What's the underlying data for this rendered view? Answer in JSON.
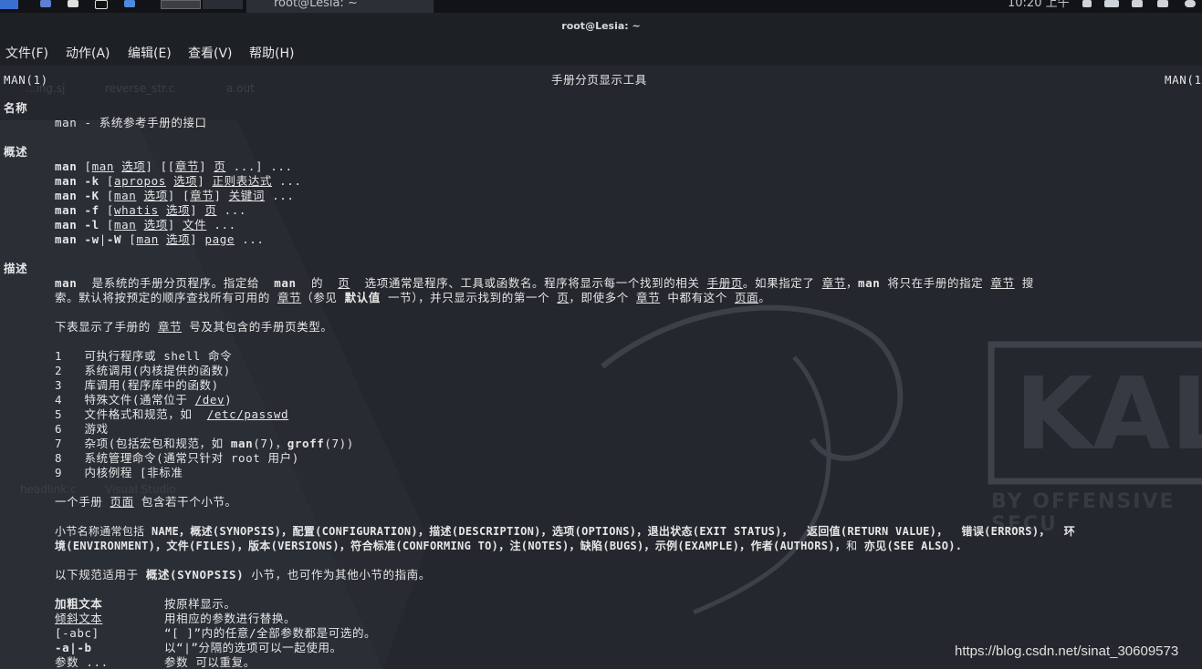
{
  "panel": {
    "window_title": "root@Lesia: ~",
    "time": "10:20 上午"
  },
  "titlebar": {
    "title": "root@Lesia: ~"
  },
  "menu": [
    {
      "label": "文件(F)"
    },
    {
      "label": "动作(A)"
    },
    {
      "label": "编辑(E)"
    },
    {
      "label": "查看(V)"
    },
    {
      "label": "帮助(H)"
    }
  ],
  "desktop_ghost": {
    "f1": "...ing.sj",
    "f2": "reverse_str.c",
    "f3": "a.out",
    "f4": "headlink.c",
    "f5": "Visual Studio",
    "wall_brand": "KAL",
    "wall_tagline": "BY OFFENSIVE SECU"
  },
  "man": {
    "header_left": "MAN(1)",
    "header_center": "手册分页显示工具",
    "header_right": "MAN(1",
    "sec_name": "名称",
    "name_line": "man - 系统参考手册的接口",
    "sec_synopsis": "概述",
    "syn1": {
      "cmd": "man",
      "t1": " [",
      "u1": "man",
      "t2": " ",
      "u2": "选项",
      "t3": "] [[",
      "u3": "章节",
      "t4": "] ",
      "u4": "页",
      "t5": " ...] ..."
    },
    "syn2": {
      "cmd": "man -k",
      "t1": " [",
      "u1": "apropos",
      "t2": " ",
      "u2": "选项",
      "t3": "] ",
      "u3": "正则表达式",
      "t4": " ..."
    },
    "syn3": {
      "cmd": "man -K",
      "t1": " [",
      "u1": "man",
      "t2": " ",
      "u2": "选项",
      "t3": "] [",
      "u3": "章节",
      "t4": "] ",
      "u4": "关键词",
      "t5": " ..."
    },
    "syn4": {
      "cmd": "man -f",
      "t1": " [",
      "u1": "whatis",
      "t2": " ",
      "u2": "选项",
      "t3": "] ",
      "u3": "页",
      "t4": " ..."
    },
    "syn5": {
      "cmd": "man -l",
      "t1": " [",
      "u1": "man",
      "t2": " ",
      "u2": "选项",
      "t3": "] ",
      "u3": "文件",
      "t4": " ..."
    },
    "syn6": {
      "cmd": "man -w",
      "t1": "|",
      "cmd2": "-W",
      "t2": " [",
      "u1": "man",
      "t3": " ",
      "u2": "选项",
      "t4": "] ",
      "u3": "page",
      "t5": " ..."
    },
    "sec_desc": "描述",
    "desc1": {
      "b1": "man",
      "t1": "  是系统的手册分页程序。指定给  ",
      "b2": "man",
      "t2": "  的  ",
      "u1": "页",
      "t3": "  选项通常是程序、工具或函数名。程序将显示每一个找到的相关 ",
      "u2": "手册页",
      "t4": "。如果指定了 ",
      "u3": "章节",
      "t5": "，",
      "b3": "man",
      "t6": " 将只在手册的指定 ",
      "u4": "章节",
      "t7": " 搜"
    },
    "desc2": {
      "t1": "索。默认将按预定的顺序查找所有可用的 ",
      "u1": "章节",
      "t2": "（参见 ",
      "b1": "默认值",
      "t3": " 一节），并只显示找到的第一个 ",
      "u2": "页",
      "t4": "，即使多个 ",
      "u3": "章节",
      "t5": " 中都有这个 ",
      "u4": "页面",
      "t6": "。"
    },
    "table_intro": {
      "t1": "下表显示了手册的 ",
      "u1": "章节",
      "t2": " 号及其包含的手册页类型。"
    },
    "sections": [
      {
        "num": "1",
        "text": "可执行程序或 shell 命令"
      },
      {
        "num": "2",
        "text": "系统调用(内核提供的函数)"
      },
      {
        "num": "3",
        "text": "库调用(程序库中的函数)"
      },
      {
        "num": "4",
        "text": "特殊文件(通常位于 ",
        "u": "/dev",
        "tail": ")"
      },
      {
        "num": "5",
        "text": "文件格式和规范，如  ",
        "u": "/etc/passwd",
        "tail": ""
      },
      {
        "num": "6",
        "text": "游戏"
      },
      {
        "num": "7",
        "text": "杂项(包括宏包和规范，如 ",
        "b1": "man",
        "m1": "(7)，",
        "b2": "groff",
        "m2": "(7))"
      },
      {
        "num": "8",
        "text": "系统管理命令(通常只针对 root 用户)"
      },
      {
        "num": "9",
        "text": "内核例程 [非标准"
      }
    ],
    "pages_line": {
      "t1": "一个手册 ",
      "u1": "页面",
      "t2": " 包含若干个小节。"
    },
    "subsec1": {
      "t1": "小节名称通常包括 ",
      "b1": "NAME，概述(SYNOPSIS)，配置(CONFIGURATION)，描述(DESCRIPTION)，选项(OPTIONS)，退出状态(EXIT STATUS)，  返回值(RETURN VALUE)，  错误(ERRORS)，  环"
    },
    "subsec2": {
      "b1": "境(ENVIRONMENT)，文件(FILES)，版本(VERSIONS)，符合标准(CONFORMING TO)，注(NOTES)，缺陷(BUGS)，示例(EXAMPLE)，作者(AUTHORS)，",
      "t1": "和 ",
      "b2": "亦见(SEE ALSO)."
    },
    "conv_intro": {
      "t1": "以下规范适用于 ",
      "b1": "概述(SYNOPSIS)",
      "t2": " 小节，也可作为其他小节的指南。"
    },
    "conv": [
      {
        "key": "加粗文本",
        "style": "b",
        "desc": "按原样显示。"
      },
      {
        "key": "倾斜文本",
        "style": "u",
        "desc": "用相应的参数进行替换。"
      },
      {
        "key": "[-abc]",
        "style": "",
        "desc": "“[ ]”内的任意/全部参数都是可选的。"
      },
      {
        "key": "-a|-b",
        "style": "b",
        "desc": "以“|”分隔的选项可以一起使用。"
      },
      {
        "key": "参数 ...",
        "style": "",
        "desc": "参数 可以重复。"
      }
    ]
  },
  "watermark": "https://blog.csdn.net/sinat_30609573",
  "colors": {
    "terminal_bg": "#24272d",
    "text": "#e6e6e6",
    "panel_bg": "#111317"
  }
}
